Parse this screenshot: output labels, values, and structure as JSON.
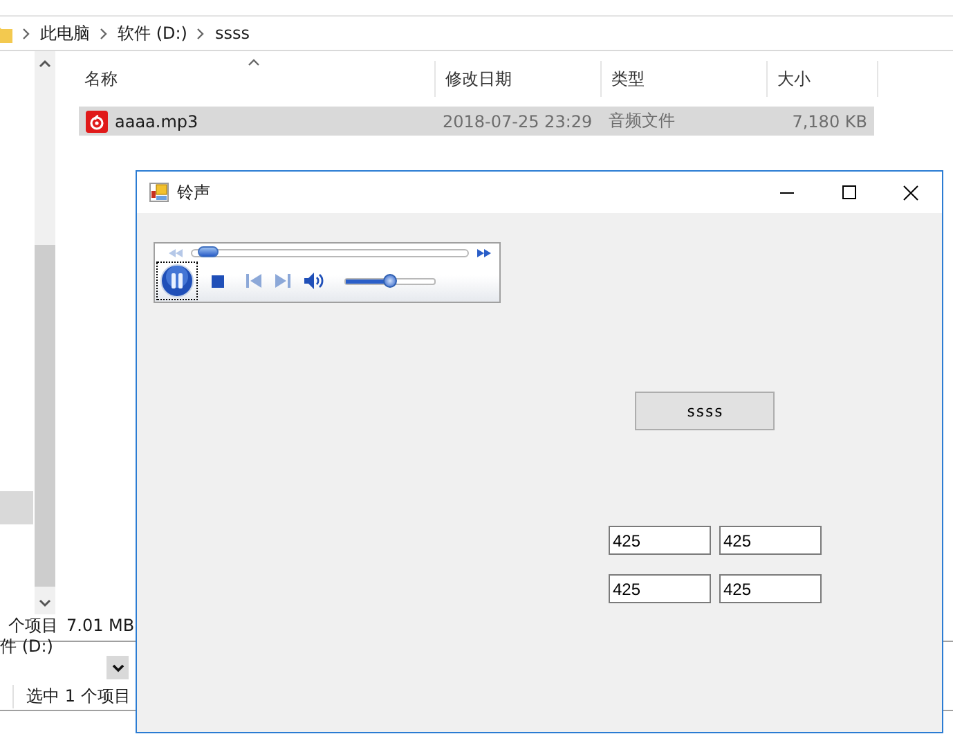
{
  "explorer": {
    "breadcrumb": [
      "此电脑",
      "软件 (D:)",
      "ssss"
    ],
    "columns": [
      {
        "label": "名称",
        "sorted": true
      },
      {
        "label": "修改日期",
        "sorted": false
      },
      {
        "label": "类型",
        "sorted": false
      },
      {
        "label": "大小",
        "sorted": false
      }
    ],
    "rows": [
      {
        "name": "aaaa.mp3",
        "modified": "2018-07-25 23:29",
        "type": "音频文件",
        "size": "7,180 KB",
        "selected": true
      }
    ],
    "status": {
      "count": "个项目",
      "size": "7.01 MB"
    }
  },
  "back_window": {
    "drive": "件 (D:)",
    "status": "选中 1 个项目"
  },
  "dialog": {
    "title": "铃声",
    "player": {
      "playing": true,
      "position": {
        "level": 0.03
      },
      "volume": {
        "level": 0.5
      }
    },
    "button": "ssss",
    "fields": [
      "425",
      "425",
      "425",
      "425"
    ]
  }
}
